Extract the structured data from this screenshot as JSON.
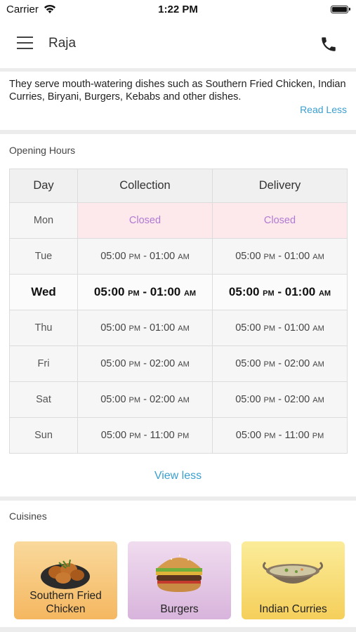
{
  "status": {
    "carrier": "Carrier",
    "time": "1:22 PM"
  },
  "nav": {
    "title": "Raja"
  },
  "about": {
    "text": "They serve mouth-watering dishes such as Southern Fried Chicken, Indian Curries, Biryani, Burgers, Kebabs   and other dishes.",
    "toggle": "Read Less"
  },
  "opening_hours": {
    "heading": "Opening Hours",
    "columns": [
      "Day",
      "Collection",
      "Delivery"
    ],
    "rows": [
      {
        "day": "Mon",
        "collection": {
          "text": "Closed"
        },
        "delivery": {
          "text": "Closed"
        }
      },
      {
        "day": "Tue",
        "collection": {
          "open": "05:00",
          "open_ampm": "PM",
          "close": "01:00",
          "close_ampm": "AM"
        },
        "delivery": {
          "open": "05:00",
          "open_ampm": "PM",
          "close": "01:00",
          "close_ampm": "AM"
        }
      },
      {
        "day": "Wed",
        "collection": {
          "open": "05:00",
          "open_ampm": "PM",
          "close": "01:00",
          "close_ampm": "AM"
        },
        "delivery": {
          "open": "05:00",
          "open_ampm": "PM",
          "close": "01:00",
          "close_ampm": "AM"
        }
      },
      {
        "day": "Thu",
        "collection": {
          "open": "05:00",
          "open_ampm": "PM",
          "close": "01:00",
          "close_ampm": "AM"
        },
        "delivery": {
          "open": "05:00",
          "open_ampm": "PM",
          "close": "01:00",
          "close_ampm": "AM"
        }
      },
      {
        "day": "Fri",
        "collection": {
          "open": "05:00",
          "open_ampm": "PM",
          "close": "02:00",
          "close_ampm": "AM"
        },
        "delivery": {
          "open": "05:00",
          "open_ampm": "PM",
          "close": "02:00",
          "close_ampm": "AM"
        }
      },
      {
        "day": "Sat",
        "collection": {
          "open": "05:00",
          "open_ampm": "PM",
          "close": "02:00",
          "close_ampm": "AM"
        },
        "delivery": {
          "open": "05:00",
          "open_ampm": "PM",
          "close": "02:00",
          "close_ampm": "AM"
        }
      },
      {
        "day": "Sun",
        "collection": {
          "open": "05:00",
          "open_ampm": "PM",
          "close": "11:00",
          "close_ampm": "PM"
        },
        "delivery": {
          "open": "05:00",
          "open_ampm": "PM",
          "close": "11:00",
          "close_ampm": "PM"
        }
      }
    ],
    "separator": " - ",
    "toggle": "View less"
  },
  "cuisines": {
    "heading": "Cuisines",
    "items": [
      {
        "label": "Southern Fried Chicken",
        "icon": "fried-chicken-icon",
        "bg_top": "#f9d99c",
        "bg_bottom": "#f5b760"
      },
      {
        "label": "Burgers",
        "icon": "burger-icon",
        "bg_top": "#f0dcef",
        "bg_bottom": "#d8b4dc"
      },
      {
        "label": "Indian Curries",
        "icon": "curry-icon",
        "bg_top": "#fbec9a",
        "bg_bottom": "#f5cf5a"
      }
    ]
  },
  "colors": {
    "accent": "#3a9fd0",
    "closed_text": "#b07ad0",
    "closed_bg": "#fde8ec"
  }
}
